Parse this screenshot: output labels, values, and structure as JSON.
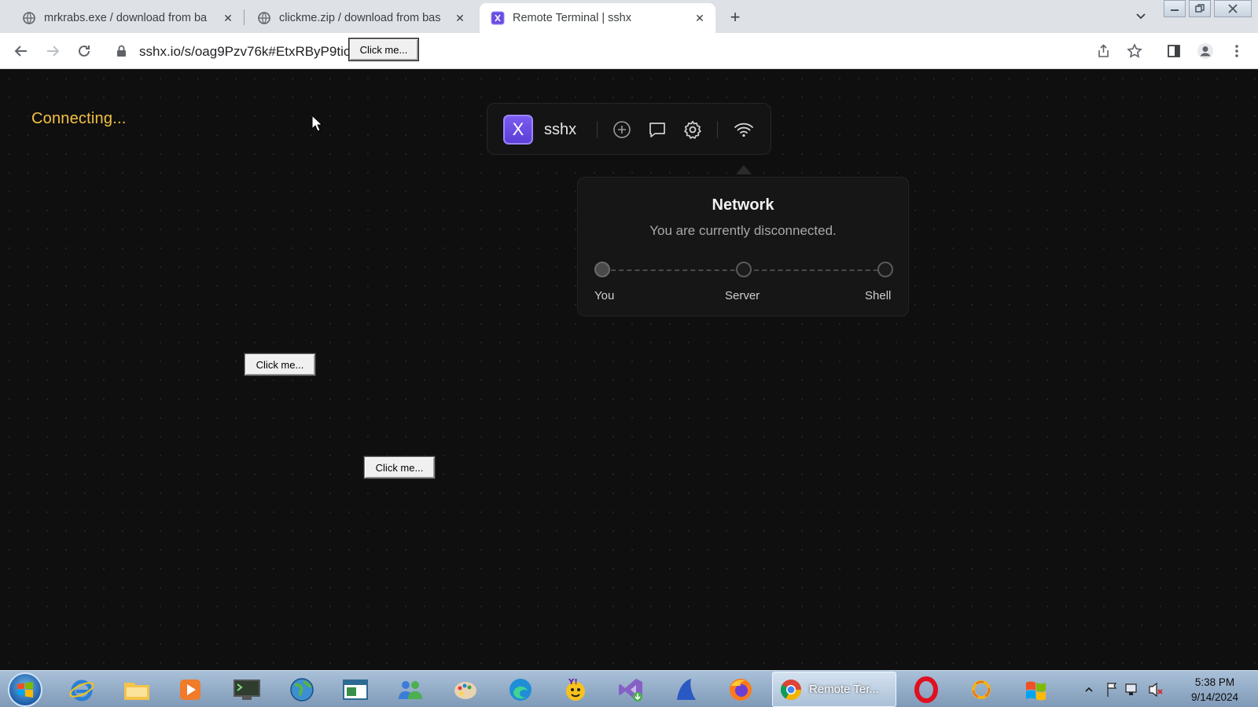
{
  "tabs": [
    {
      "title": "mrkrabs.exe / download from ba",
      "active": false
    },
    {
      "title": "clickme.zip / download from bas",
      "active": false
    },
    {
      "title": "Remote Terminal | sshx",
      "active": true
    }
  ],
  "address_bar": {
    "url": "sshx.io/s/oag9Pzv76k#EtxRByP9tic"
  },
  "popup_buttons": {
    "label": "Click me..."
  },
  "page": {
    "status_text": "Connecting...",
    "app_logo_letter": "X",
    "app_name": "sshx"
  },
  "network_panel": {
    "title": "Network",
    "subtitle": "You are currently disconnected.",
    "nodes": [
      "You",
      "Server",
      "Shell"
    ]
  },
  "taskbar": {
    "active_app_label": "Remote Ter...",
    "apps": [
      "internet-explorer",
      "file-explorer",
      "media-player",
      "terminal",
      "world-globe",
      "notepad",
      "people",
      "paint",
      "edge",
      "yahoo-messenger",
      "visual-studio",
      "blue-app",
      "firefox",
      "chrome",
      "opera",
      "yellow-ring",
      "windows-flag"
    ]
  },
  "clock": {
    "time": "5:38 PM",
    "date": "9/14/2024"
  },
  "colors": {
    "accent_purple": "#6a4ee0",
    "status_yellow": "#f5c242",
    "page_bg": "#0f0f0f"
  }
}
